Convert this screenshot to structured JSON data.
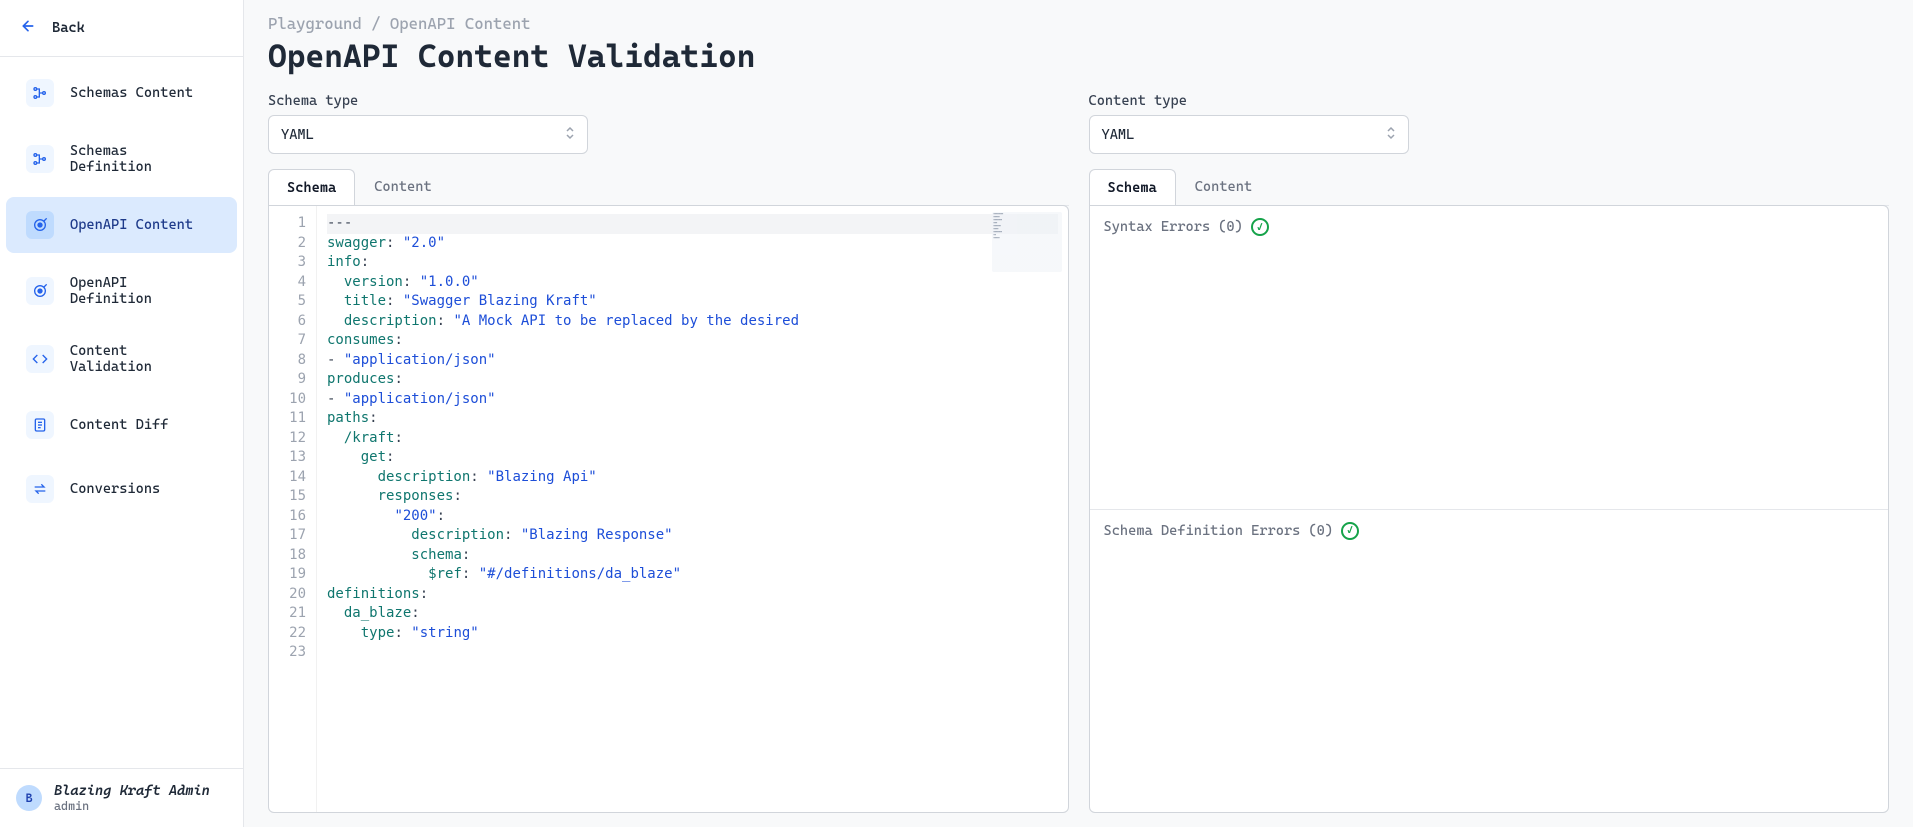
{
  "sidebar": {
    "back_label": "Back",
    "items": [
      {
        "label": "Schemas Content",
        "icon": "schema-nodes-icon"
      },
      {
        "label": "Schemas Definition",
        "icon": "schema-nodes-icon"
      },
      {
        "label": "OpenAPI Content",
        "icon": "target-icon",
        "active": true
      },
      {
        "label": "OpenAPI Definition",
        "icon": "target-icon"
      },
      {
        "label": "Content Validation",
        "icon": "code-icon"
      },
      {
        "label": "Content Diff",
        "icon": "document-icon"
      },
      {
        "label": "Conversions",
        "icon": "swap-icon"
      }
    ],
    "user": {
      "initial": "B",
      "name": "Blazing Kraft Admin",
      "role": "admin"
    }
  },
  "breadcrumb": "Playground / OpenAPI Content",
  "page_title": "OpenAPI Content Validation",
  "left": {
    "field_label": "Schema type",
    "select_value": "YAML",
    "tabs": [
      "Schema",
      "Content"
    ],
    "active_tab": 0,
    "code_lines": [
      {
        "n": 1,
        "tokens": [
          {
            "t": "---",
            "c": "dash"
          }
        ],
        "active": true
      },
      {
        "n": 2,
        "tokens": [
          {
            "t": "swagger",
            "c": "key"
          },
          {
            "t": ": ",
            "c": "punc"
          },
          {
            "t": "\"2.0\"",
            "c": "str"
          }
        ]
      },
      {
        "n": 3,
        "tokens": [
          {
            "t": "info",
            "c": "key"
          },
          {
            "t": ":",
            "c": "punc"
          }
        ]
      },
      {
        "n": 4,
        "tokens": [
          {
            "t": "  ",
            "c": "punc"
          },
          {
            "t": "version",
            "c": "key"
          },
          {
            "t": ": ",
            "c": "punc"
          },
          {
            "t": "\"1.0.0\"",
            "c": "str"
          }
        ]
      },
      {
        "n": 5,
        "tokens": [
          {
            "t": "  ",
            "c": "punc"
          },
          {
            "t": "title",
            "c": "key"
          },
          {
            "t": ": ",
            "c": "punc"
          },
          {
            "t": "\"Swagger Blazing Kraft\"",
            "c": "str"
          }
        ]
      },
      {
        "n": 6,
        "tokens": [
          {
            "t": "  ",
            "c": "punc"
          },
          {
            "t": "description",
            "c": "key"
          },
          {
            "t": ": ",
            "c": "punc"
          },
          {
            "t": "\"A Mock API to be replaced by the desired",
            "c": "str"
          }
        ]
      },
      {
        "n": 7,
        "tokens": [
          {
            "t": "consumes",
            "c": "key"
          },
          {
            "t": ":",
            "c": "punc"
          }
        ]
      },
      {
        "n": 8,
        "tokens": [
          {
            "t": "- ",
            "c": "punc"
          },
          {
            "t": "\"application/json\"",
            "c": "str"
          }
        ]
      },
      {
        "n": 9,
        "tokens": [
          {
            "t": "produces",
            "c": "key"
          },
          {
            "t": ":",
            "c": "punc"
          }
        ]
      },
      {
        "n": 10,
        "tokens": [
          {
            "t": "- ",
            "c": "punc"
          },
          {
            "t": "\"application/json\"",
            "c": "str"
          }
        ]
      },
      {
        "n": 11,
        "tokens": [
          {
            "t": "paths",
            "c": "key"
          },
          {
            "t": ":",
            "c": "punc"
          }
        ]
      },
      {
        "n": 12,
        "tokens": [
          {
            "t": "  ",
            "c": "punc"
          },
          {
            "t": "/kraft",
            "c": "key"
          },
          {
            "t": ":",
            "c": "punc"
          }
        ]
      },
      {
        "n": 13,
        "tokens": [
          {
            "t": "    ",
            "c": "punc"
          },
          {
            "t": "get",
            "c": "key"
          },
          {
            "t": ":",
            "c": "punc"
          }
        ]
      },
      {
        "n": 14,
        "tokens": [
          {
            "t": "      ",
            "c": "punc"
          },
          {
            "t": "description",
            "c": "key"
          },
          {
            "t": ": ",
            "c": "punc"
          },
          {
            "t": "\"Blazing Api\"",
            "c": "str"
          }
        ]
      },
      {
        "n": 15,
        "tokens": [
          {
            "t": "      ",
            "c": "punc"
          },
          {
            "t": "responses",
            "c": "key"
          },
          {
            "t": ":",
            "c": "punc"
          }
        ]
      },
      {
        "n": 16,
        "tokens": [
          {
            "t": "        ",
            "c": "punc"
          },
          {
            "t": "\"200\"",
            "c": "str"
          },
          {
            "t": ":",
            "c": "punc"
          }
        ]
      },
      {
        "n": 17,
        "tokens": [
          {
            "t": "          ",
            "c": "punc"
          },
          {
            "t": "description",
            "c": "key"
          },
          {
            "t": ": ",
            "c": "punc"
          },
          {
            "t": "\"Blazing Response\"",
            "c": "str"
          }
        ]
      },
      {
        "n": 18,
        "tokens": [
          {
            "t": "          ",
            "c": "punc"
          },
          {
            "t": "schema",
            "c": "key"
          },
          {
            "t": ":",
            "c": "punc"
          }
        ]
      },
      {
        "n": 19,
        "tokens": [
          {
            "t": "            ",
            "c": "punc"
          },
          {
            "t": "$ref",
            "c": "key"
          },
          {
            "t": ": ",
            "c": "punc"
          },
          {
            "t": "\"#/definitions/da_blaze\"",
            "c": "str"
          }
        ]
      },
      {
        "n": 20,
        "tokens": [
          {
            "t": "definitions",
            "c": "key"
          },
          {
            "t": ":",
            "c": "punc"
          }
        ]
      },
      {
        "n": 21,
        "tokens": [
          {
            "t": "  ",
            "c": "punc"
          },
          {
            "t": "da_blaze",
            "c": "key"
          },
          {
            "t": ":",
            "c": "punc"
          }
        ]
      },
      {
        "n": 22,
        "tokens": [
          {
            "t": "    ",
            "c": "punc"
          },
          {
            "t": "type",
            "c": "key"
          },
          {
            "t": ": ",
            "c": "punc"
          },
          {
            "t": "\"string\"",
            "c": "str"
          }
        ]
      },
      {
        "n": 23,
        "tokens": []
      }
    ]
  },
  "right": {
    "field_label": "Content type",
    "select_value": "YAML",
    "tabs": [
      "Schema",
      "Content"
    ],
    "active_tab": 0,
    "error_blocks": [
      {
        "label": "Syntax Errors",
        "count": 0
      },
      {
        "label": "Schema Definition Errors",
        "count": 0
      }
    ]
  }
}
